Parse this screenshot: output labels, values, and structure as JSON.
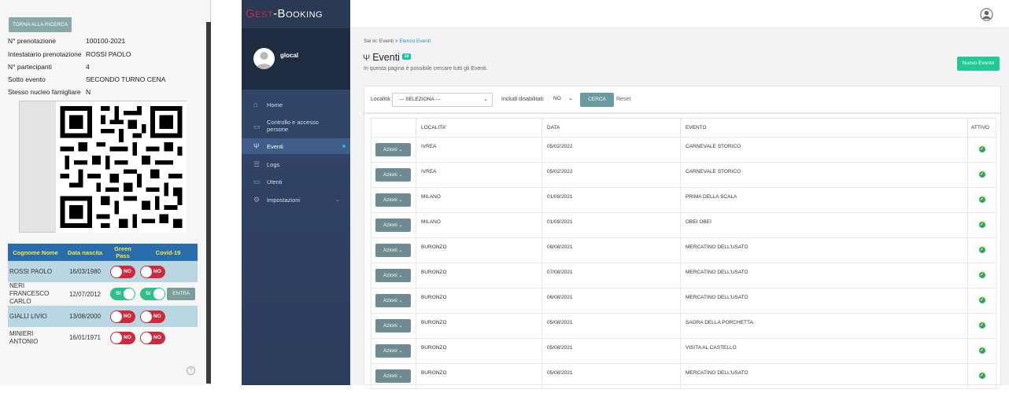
{
  "mobile": {
    "back_label": "TORNA ALLA RICERCA",
    "info": [
      {
        "label": "N° prenotazione",
        "value": "100100-2021"
      },
      {
        "label": "Intestatario prenotazione",
        "value": "ROSSI PAOLO"
      },
      {
        "label": "N° partecipanti",
        "value": "4"
      },
      {
        "label": "Sotto evento",
        "value": "SECONDO TURNO CENA"
      },
      {
        "label": "Stesso nucleo famigliare",
        "value": "N"
      }
    ],
    "table": {
      "headers": [
        "Cognome Nome",
        "Data nascita",
        "Green Pass",
        "Covid-19"
      ],
      "rows": [
        {
          "name": "ROSSI PAOLO",
          "birth": "16/03/1980",
          "green_pass": "NO",
          "covid": "NO",
          "action": ""
        },
        {
          "name": "NERI FRANCESCO CARLO",
          "birth": "12/07/2012",
          "green_pass": "SI",
          "covid": "SI",
          "action": "ENTRA"
        },
        {
          "name": "GIALLI LIVIO",
          "birth": "13/08/2000",
          "green_pass": "NO",
          "covid": "NO",
          "action": ""
        },
        {
          "name": "MINIERI ANTONIO",
          "birth": "16/01/1971",
          "green_pass": "NO",
          "covid": "NO",
          "action": ""
        }
      ]
    },
    "help_icon": "question-circle-icon"
  },
  "app": {
    "brand": {
      "part1": "Gest",
      "part2": "-Booking"
    },
    "user": {
      "name": "glocal"
    },
    "nav": [
      {
        "label": "Home",
        "icon": "home-icon",
        "active": false
      },
      {
        "label": "Controllo e accesso persone",
        "icon": "id-card-icon",
        "active": false
      },
      {
        "label": "Eventi",
        "icon": "cutlery-icon",
        "active": true
      },
      {
        "label": "Logs",
        "icon": "list-icon",
        "active": false
      },
      {
        "label": "Utenti",
        "icon": "users-icon",
        "active": false
      },
      {
        "label": "Impostazioni",
        "icon": "gear-icon",
        "active": false
      }
    ],
    "breadcrumb": {
      "prefix": "Sei in: Eventi > ",
      "current": "Elenco Eventi"
    },
    "title": "Eventi",
    "title_badge": "10",
    "description": "In questa pagina è possibile cercare tutti gli Eventi.",
    "new_event_label": "Nuovo Evento",
    "filters": {
      "localita_label": "Località:",
      "localita_value": "--- SELEZIONA ---",
      "disabilitati_label": "Includi disabilitati:",
      "disabilitati_value": "NO",
      "search_label": "CERCA",
      "reset_label": "Reset"
    },
    "table": {
      "headers": [
        "",
        "LOCALITA'",
        "DATA",
        "EVENTO",
        "ATTIVO"
      ],
      "action_label": "Azioni",
      "rows": [
        {
          "localita": "IVREA",
          "data": "05/02/2022",
          "evento": "CARNEVALE STORICO"
        },
        {
          "localita": "IVREA",
          "data": "05/02/2022",
          "evento": "CARNEVALE STORICO"
        },
        {
          "localita": "MILANO",
          "data": "01/09/2021",
          "evento": "PRIMA DELLA SCALA"
        },
        {
          "localita": "MILANO",
          "data": "01/09/2021",
          "evento": "OBEI OBEI"
        },
        {
          "localita": "BURONZO",
          "data": "08/08/2021",
          "evento": "MERCATINO DELL'USATO"
        },
        {
          "localita": "BURONZO",
          "data": "07/08/2021",
          "evento": "MERCATINO DELL'USATO"
        },
        {
          "localita": "BURONZO",
          "data": "06/08/2021",
          "evento": "MERCATINO DELL'USATO"
        },
        {
          "localita": "BURONZO",
          "data": "05/08/2021",
          "evento": "SAGRA DELLA PORCHETTA"
        },
        {
          "localita": "BURONZO",
          "data": "05/08/2021",
          "evento": "VISITA AL CASTELLO"
        },
        {
          "localita": "BURONZO",
          "data": "05/08/2021",
          "evento": "MERCATINO DELL'USATO"
        }
      ]
    }
  }
}
